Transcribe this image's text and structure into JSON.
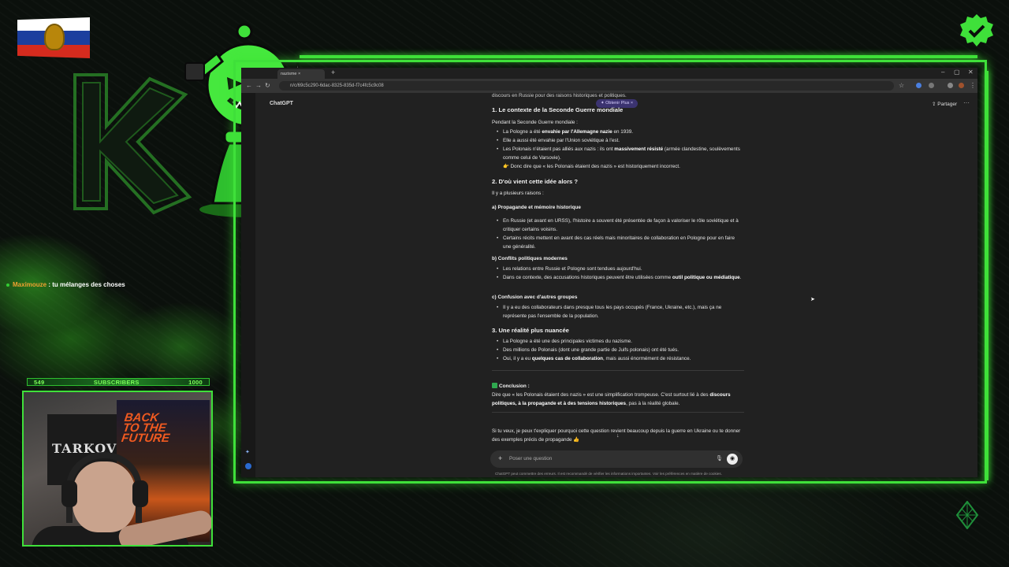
{
  "overlay": {
    "chat": {
      "user": "Maximouze",
      "message": " : tu mélanges des choses"
    },
    "subscribers": {
      "current": "549",
      "label": "SUBSCRIBERS",
      "goal": "1000"
    },
    "colors": {
      "accent": "#3fe03a",
      "flag_white": "#ffffff",
      "flag_blue": "#1c3f9e",
      "flag_red": "#d52b1e"
    }
  },
  "browser": {
    "tab_title": "nazisme",
    "url": "chatgpt.com/c/69c5c290-6dac-8325-835d-f7c4fc5c9c08",
    "url_visible": "n/c/69c5c290-6dac-8325-835d-f7c4fc5c9c08"
  },
  "chat": {
    "title": "ChatGPT",
    "share_label": "Partager",
    "upsell_label": "✦ Obtenir Plus ×",
    "intro": "discours en Russie pour des raisons historiques et politiques.",
    "s1_title": "1. Le contexte de la Seconde Guerre mondiale",
    "s1_lead": "Pendant la Seconde Guerre mondiale :",
    "s1_b1_pre": "La Pologne a été ",
    "s1_b1_bold": "envahie par l'Allemagne nazie",
    "s1_b1_post": " en 1939.",
    "s1_b2": "Elle a aussi été envahie par l'Union soviétique à l'est.",
    "s1_b3_pre": "Les Polonais n'étaient pas alliés aux nazis : ils ont ",
    "s1_b3_bold": "massivement résisté",
    "s1_b3_post": " (armée clandestine, soulèvements comme celui de Varsovie).",
    "s1_point": "👉 Donc dire que « les Polonais étaient des nazis » est historiquement incorrect.",
    "s2_title": "2. D'où vient cette idée alors ?",
    "s2_lead": "Il y a plusieurs raisons :",
    "s2a_title": "a) Propagande et mémoire historique",
    "s2a_b1": "En Russie (et avant en URSS), l'histoire a souvent été présentée de façon à valoriser le rôle soviétique et à critiquer certains voisins.",
    "s2a_b2": "Certains récits mettent en avant des cas réels mais minoritaires de collaboration en Pologne pour en faire une généralité.",
    "s2b_title": "b) Conflits politiques modernes",
    "s2b_b1": "Les relations entre Russie et Pologne sont tendues aujourd'hui.",
    "s2b_b2_pre": "Dans ce contexte, des accusations historiques peuvent être utilisées comme ",
    "s2b_b2_bold": "outil politique ou médiatique",
    "s2b_b2_post": ".",
    "s2c_title": "c) Confusion avec d'autres groupes",
    "s2c_b1": "Il y a eu des collaborateurs dans presque tous les pays occupés (France, Ukraine, etc.), mais ça ne représente pas l'ensemble de la population.",
    "s3_title": "3. Une réalité plus nuancée",
    "s3_b1": "La Pologne a été une des principales victimes du nazisme.",
    "s3_b2": "Des millions de Polonais (dont une grande partie de Juifs polonais) ont été tués.",
    "s3_b3_pre": "Oui, il y a eu ",
    "s3_b3_bold": "quelques cas de collaboration",
    "s3_b3_post": ", mais aussi énormément de résistance.",
    "conclusion_title": "Conclusion :",
    "conclusion_pre": "Dire que « les Polonais étaient des nazis » est une simplification trompeuse. C'est surtout lié à des ",
    "conclusion_bold": "discours politiques, à la propagande et à des tensions historiques",
    "conclusion_post": ", pas à la réalité globale.",
    "followup": "Si tu veux, je peux t'expliquer pourquoi cette question revient beaucoup depuis la guerre en Ukraine ou te donner des exemples précis de propagande 👍",
    "composer_placeholder": "Poser une question",
    "disclaimer": "ChatGPT peut commettre des erreurs. Il est recommandé de vérifier les informations importantes. Voir les préférences en matière de cookies."
  }
}
